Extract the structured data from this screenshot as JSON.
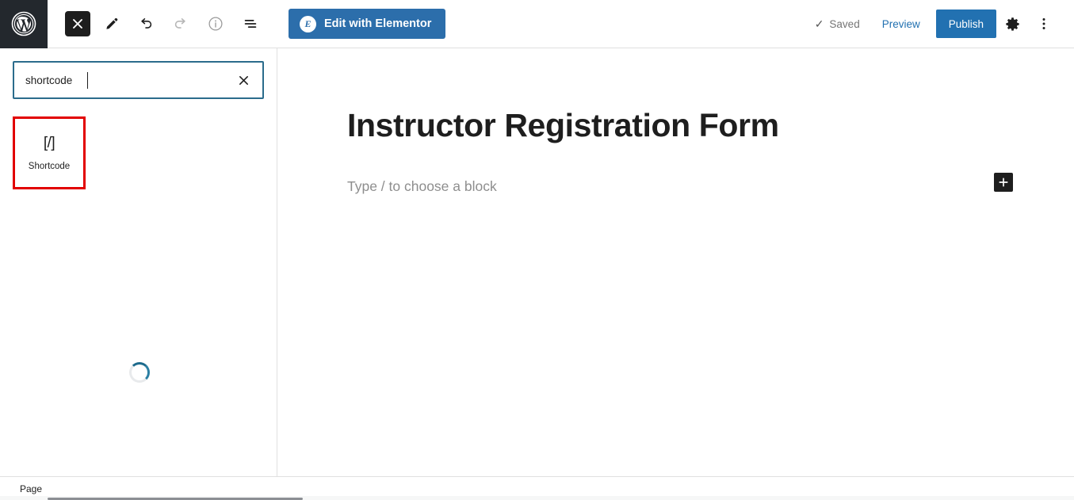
{
  "topbar": {
    "wp_logo_icon": "wordpress-logo-icon",
    "tools": [
      {
        "name": "close-block-inserter-button",
        "icon": "close-x-icon",
        "state": "active",
        "disabled": false
      },
      {
        "name": "edit-tool-button",
        "icon": "pencil-icon",
        "state": "default",
        "disabled": false
      },
      {
        "name": "undo-button",
        "icon": "undo-arrow-icon",
        "state": "default",
        "disabled": false
      },
      {
        "name": "redo-button",
        "icon": "redo-arrow-icon",
        "state": "disabled",
        "disabled": true
      },
      {
        "name": "details-button",
        "icon": "info-circle-icon",
        "state": "default",
        "disabled": false
      },
      {
        "name": "list-view-button",
        "icon": "list-view-icon",
        "state": "default",
        "disabled": false
      }
    ],
    "elementor_button": {
      "label": "Edit with Elementor",
      "logo_letter": "E",
      "bg_color": "#2c6eab"
    },
    "saved_label": "Saved",
    "saved_check": "✓",
    "preview_label": "Preview",
    "publish_label": "Publish",
    "publish_color": "#2271b1",
    "settings_icon": "gear-icon",
    "more_menu_icon": "three-dots-vertical-icon"
  },
  "inserter": {
    "search": {
      "value": "shortcode",
      "placeholder": "Search",
      "clear_icon": "close-x-icon",
      "border_color": "#2b6c8c"
    },
    "results": [
      {
        "label": "Shortcode",
        "icon_glyph": "[/]",
        "highlight_color": "#e20000",
        "highlighted": true
      }
    ],
    "loading_spinner": {
      "visible": true,
      "arc_color": "#1d6a8c",
      "track_color": "#e8eaec"
    }
  },
  "canvas": {
    "post_title": "Instructor Registration Form",
    "block_placeholder": "Type / to choose a block",
    "add_block_button": {
      "icon": "plus-icon",
      "bg_color": "#1e1e1e"
    }
  },
  "bottombar": {
    "breadcrumb": "Page"
  }
}
